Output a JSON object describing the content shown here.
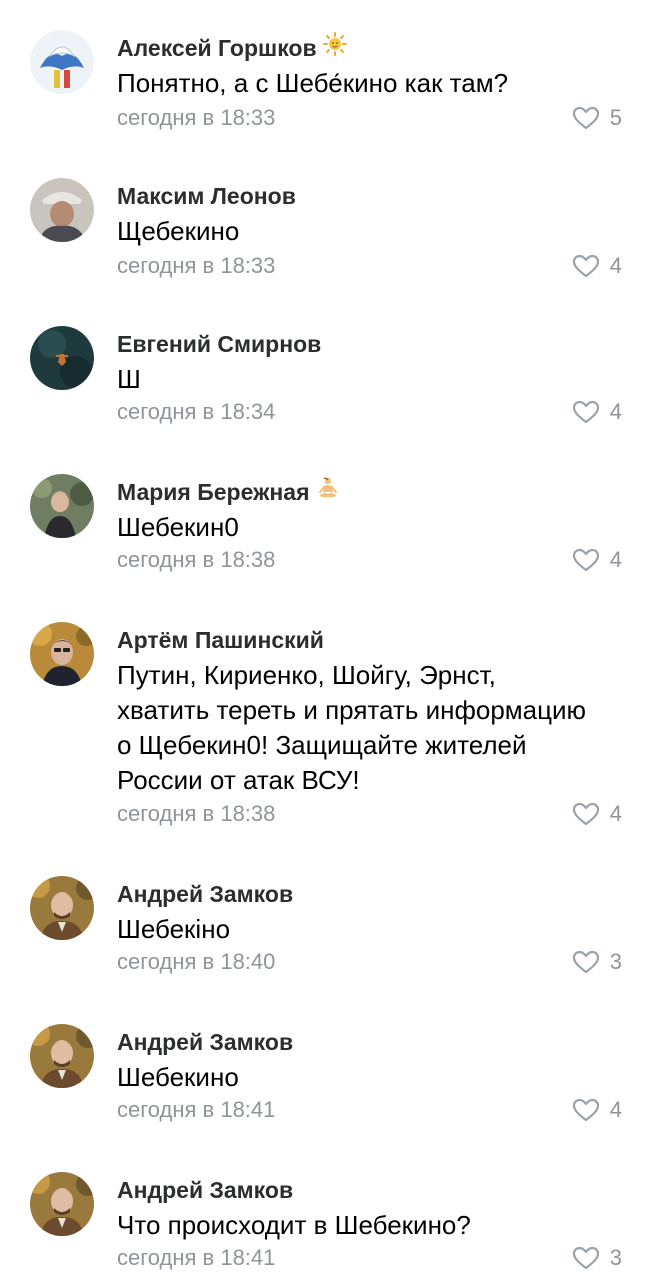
{
  "comments": [
    {
      "author": "Алексей Горшков",
      "badge_icon": "sun-icon",
      "text_lines": [
        "Понятно, а с Шебе́кино как там?"
      ],
      "time": "сегодня в 18:33",
      "likes": "5"
    },
    {
      "author": "Максим Леонов",
      "text_lines": [
        "Щебекино"
      ],
      "time": "сегодня в 18:33",
      "likes": "4"
    },
    {
      "author": "Евгений Смирнов",
      "text_lines": [
        "Ш"
      ],
      "time": "сегодня в 18:34",
      "likes": "4"
    },
    {
      "author": "Мария Бережная",
      "badge_icon": "meditating-person-icon",
      "text_lines": [
        "Шебекин0"
      ],
      "time": "сегодня в 18:38",
      "likes": "4"
    },
    {
      "author": "Артём Пашинский",
      "text_lines": [
        "Путин, Кириенко, Шойгу, Эрнст,",
        "хватить тереть и прятать информацию",
        "о Щебекин0! Защищайте жителей",
        "России от атак ВСУ!"
      ],
      "time": "сегодня в 18:38",
      "likes": "4"
    },
    {
      "author": "Андрей Замков",
      "text_lines": [
        "Шебекіно"
      ],
      "time": "сегодня в 18:40",
      "likes": "3"
    },
    {
      "author": "Андрей Замков",
      "text_lines": [
        "Шебекино"
      ],
      "time": "сегодня в 18:41",
      "likes": "4"
    },
    {
      "author": "Андрей Замков",
      "text_lines": [
        "Что происходит в Шебекино?"
      ],
      "time": "сегодня в 18:41",
      "likes": "3"
    }
  ],
  "colors": {
    "author": "#2c2d2e",
    "text": "#000000",
    "meta": "#909499",
    "like_icon": "#99a2ad"
  }
}
